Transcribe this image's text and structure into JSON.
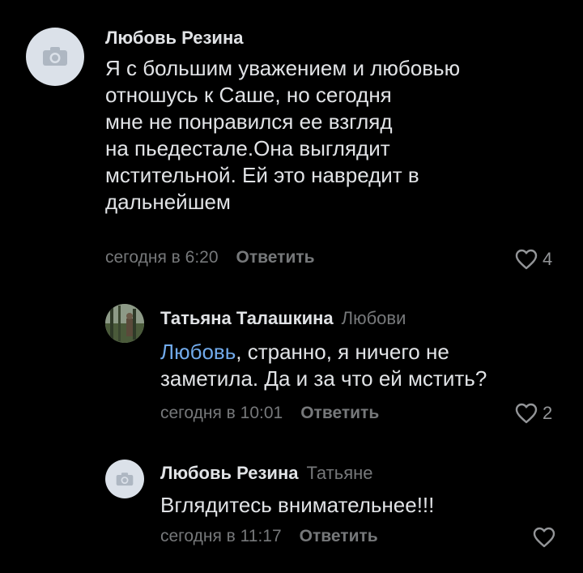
{
  "comments": [
    {
      "author": "Любовь Резина",
      "reply_to": "",
      "text": "Я с большим уважением и любовью\nотношусь к Саше, но сегодня\nмне не понравился ее взгляд\nна пьедестале.Она выглядит\nмстительной. Ей это навредит в\nдальнейшем",
      "time": "сегодня в 6:20",
      "reply_label": "Ответить",
      "likes": "4",
      "avatar_icon": "camera-icon"
    },
    {
      "author": "Татьяна Талашкина",
      "reply_to": "Любови",
      "mention": "Любовь",
      "text_rest": ", странно, я ничего не\nзаметила. Да и за что ей мстить?",
      "time": "сегодня в 10:01",
      "reply_label": "Ответить",
      "likes": "2",
      "avatar_icon": "user-photo"
    },
    {
      "author": "Любовь Резина",
      "reply_to": "Татьяне",
      "text": "Вглядитесь внимательнее!!!",
      "time": "сегодня в 11:17",
      "reply_label": "Ответить",
      "likes": "",
      "avatar_icon": "camera-icon"
    }
  ],
  "colors": {
    "background": "#000000",
    "text": "#e1e3e6",
    "secondary": "#76787a",
    "link": "#71aaeb",
    "avatar_placeholder": "#dbe1e9"
  }
}
